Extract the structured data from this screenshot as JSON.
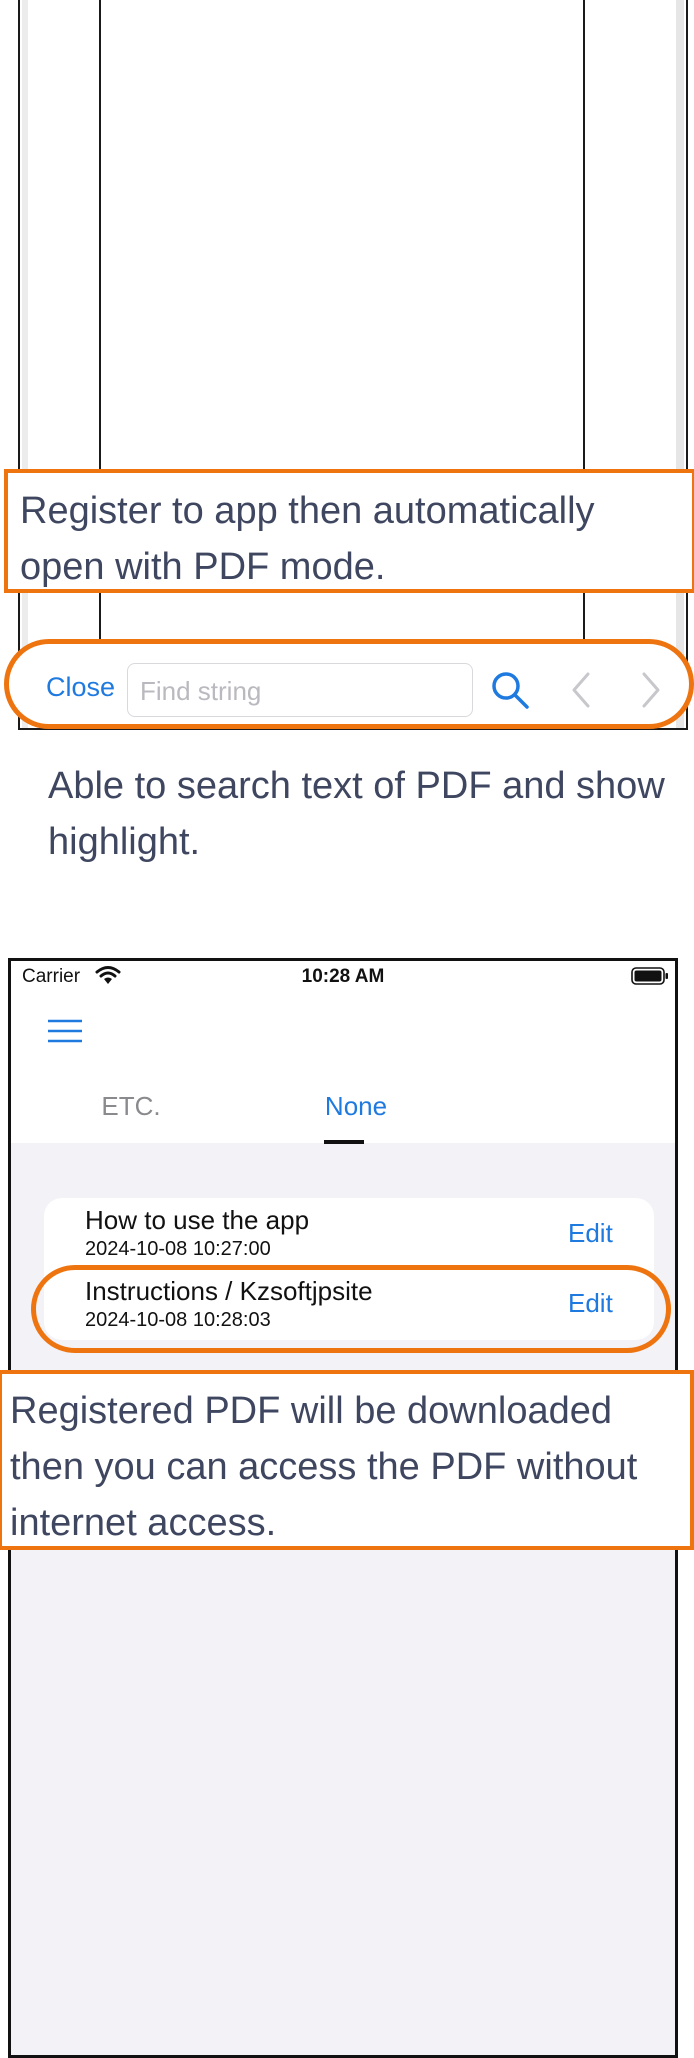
{
  "pdf_screen": {
    "callout_register": "Register to app then automatically open with PDF mode.",
    "toolbar": {
      "close_label": "Close",
      "find_placeholder": "Find string"
    },
    "caption_search": "Able to search text of PDF and show highlight."
  },
  "list_screen": {
    "status_bar": {
      "carrier": "Carrier",
      "time": "10:28 AM"
    },
    "tabs": [
      {
        "label": "ETC."
      },
      {
        "label": "None"
      }
    ],
    "items": [
      {
        "title": "How to use the app",
        "date": "2024-10-08 10:27:00",
        "action": "Edit"
      },
      {
        "title": "Instructions / Kzsoftjpsite",
        "date": "2024-10-08 10:28:03",
        "action": "Edit"
      }
    ],
    "callout_download": "Registered PDF will be downloaded then you can access the PDF without internet access."
  },
  "colors": {
    "accent": "#1f7ae0",
    "highlight": "#ee7410",
    "caption_text": "#3f4660"
  }
}
